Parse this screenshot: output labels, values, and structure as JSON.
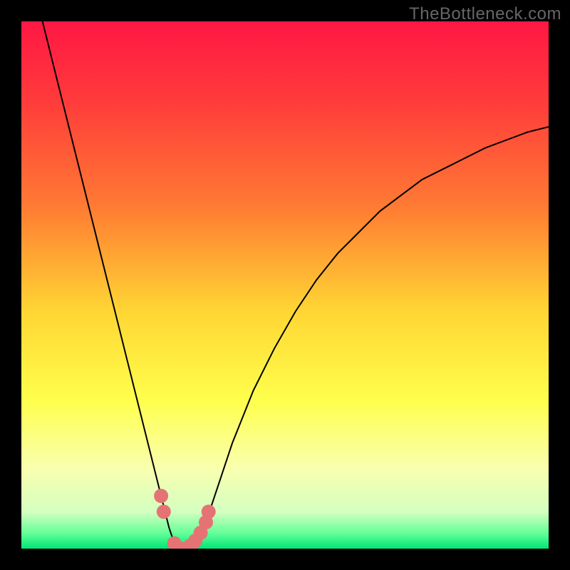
{
  "watermark": "TheBottleneck.com",
  "chart_data": {
    "type": "line",
    "title": "",
    "xlabel": "",
    "ylabel": "",
    "xlim": [
      0,
      100
    ],
    "ylim": [
      0,
      100
    ],
    "background_gradient": {
      "stops": [
        {
          "offset": 0.0,
          "color": "#ff1744"
        },
        {
          "offset": 0.15,
          "color": "#ff3b3b"
        },
        {
          "offset": 0.35,
          "color": "#ff7a33"
        },
        {
          "offset": 0.55,
          "color": "#ffd633"
        },
        {
          "offset": 0.72,
          "color": "#ffff4d"
        },
        {
          "offset": 0.85,
          "color": "#f8ffb0"
        },
        {
          "offset": 0.93,
          "color": "#d4ffc0"
        },
        {
          "offset": 0.97,
          "color": "#66ff99"
        },
        {
          "offset": 1.0,
          "color": "#00e676"
        }
      ]
    },
    "series": [
      {
        "name": "bottleneck-curve",
        "color": "#000000",
        "x": [
          4,
          6,
          8,
          10,
          12,
          14,
          16,
          18,
          20,
          22,
          24,
          26,
          27,
          28,
          29,
          30,
          31,
          32,
          33,
          34,
          36,
          38,
          40,
          44,
          48,
          52,
          56,
          60,
          64,
          68,
          72,
          76,
          80,
          84,
          88,
          92,
          96,
          100
        ],
        "y": [
          100,
          92,
          84,
          76,
          68,
          60,
          52,
          44,
          36,
          28,
          20,
          12,
          8,
          4,
          1,
          0,
          0,
          0,
          1,
          3,
          8,
          14,
          20,
          30,
          38,
          45,
          51,
          56,
          60,
          64,
          67,
          70,
          72,
          74,
          76,
          77.5,
          79,
          80
        ]
      }
    ],
    "markers": {
      "name": "bottleneck-markers",
      "color": "#e57373",
      "radius": 10,
      "points": [
        {
          "x": 26.5,
          "y": 10
        },
        {
          "x": 27,
          "y": 7
        },
        {
          "x": 29,
          "y": 1
        },
        {
          "x": 30,
          "y": 0
        },
        {
          "x": 31,
          "y": 0
        },
        {
          "x": 32,
          "y": 0.5
        },
        {
          "x": 33,
          "y": 1.5
        },
        {
          "x": 34,
          "y": 3
        },
        {
          "x": 35,
          "y": 5
        },
        {
          "x": 35.5,
          "y": 7
        }
      ]
    }
  }
}
